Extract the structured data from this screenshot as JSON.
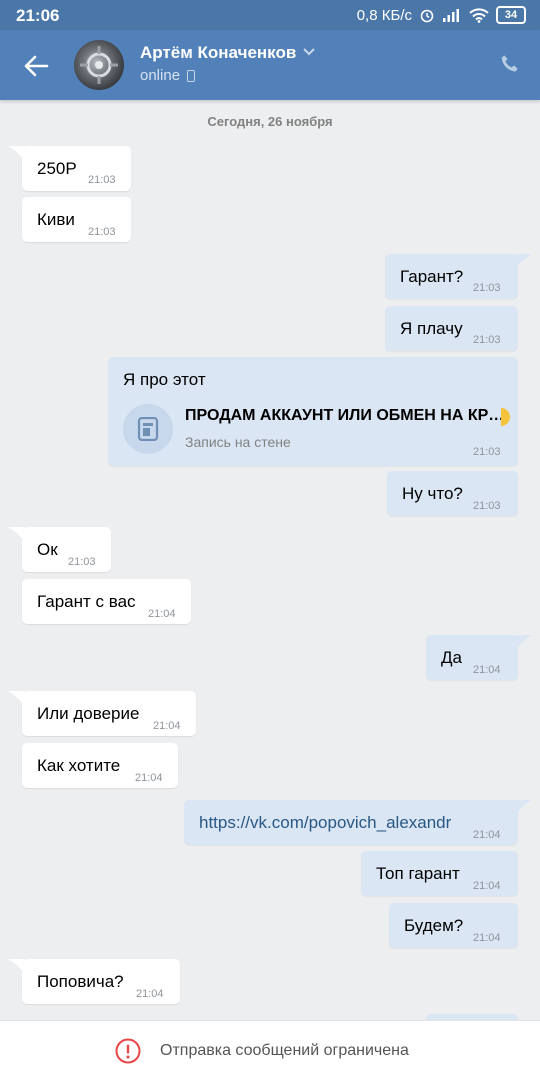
{
  "status_bar": {
    "time": "21:06",
    "network_speed": "0,8 КБ/с",
    "battery": "34"
  },
  "header": {
    "contact_name": "Артём Коначенков",
    "presence": "online"
  },
  "date_separator": "Сегодня, 26 ноября",
  "messages": [
    {
      "dir": "in",
      "text": "250Р",
      "time": "21:03"
    },
    {
      "dir": "in",
      "text": "Киви",
      "time": "21:03"
    },
    {
      "dir": "out",
      "text": "Гарант?",
      "time": "21:03"
    },
    {
      "dir": "out",
      "text": "Я плачу",
      "time": "21:03"
    },
    {
      "dir": "out",
      "text": "Я про этот",
      "time": "21:03",
      "attachment": {
        "type": "wall_post",
        "title": "ПРОДАМ АККАУНТ ИЛИ ОБМЕН НА КР…",
        "subtitle": "Запись на стене"
      }
    },
    {
      "dir": "out",
      "text": "Ну что?",
      "time": "21:03"
    },
    {
      "dir": "in",
      "text": "Ок",
      "time": "21:03"
    },
    {
      "dir": "in",
      "text": "Гарант с вас",
      "time": "21:04"
    },
    {
      "dir": "out",
      "text": "Да",
      "time": "21:04"
    },
    {
      "dir": "in",
      "text": "Или доверие",
      "time": "21:04"
    },
    {
      "dir": "in",
      "text": "Как хотите",
      "time": "21:04"
    },
    {
      "dir": "out",
      "text": "https://vk.com/popovich_alexandr",
      "time": "21:04"
    },
    {
      "dir": "out",
      "text": "Топ гарант",
      "time": "21:04"
    },
    {
      "dir": "out",
      "text": "Будем?",
      "time": "21:04"
    },
    {
      "dir": "in",
      "text": "Поповича?",
      "time": "21:04"
    }
  ],
  "bottom_notice": "Отправка сообщений ограничена",
  "colors": {
    "header_bg": "#5181b8",
    "outgoing_bubble": "#dae6f3",
    "incoming_bubble": "#ffffff",
    "chat_bg": "#edeef0",
    "warning": "#e64646"
  }
}
